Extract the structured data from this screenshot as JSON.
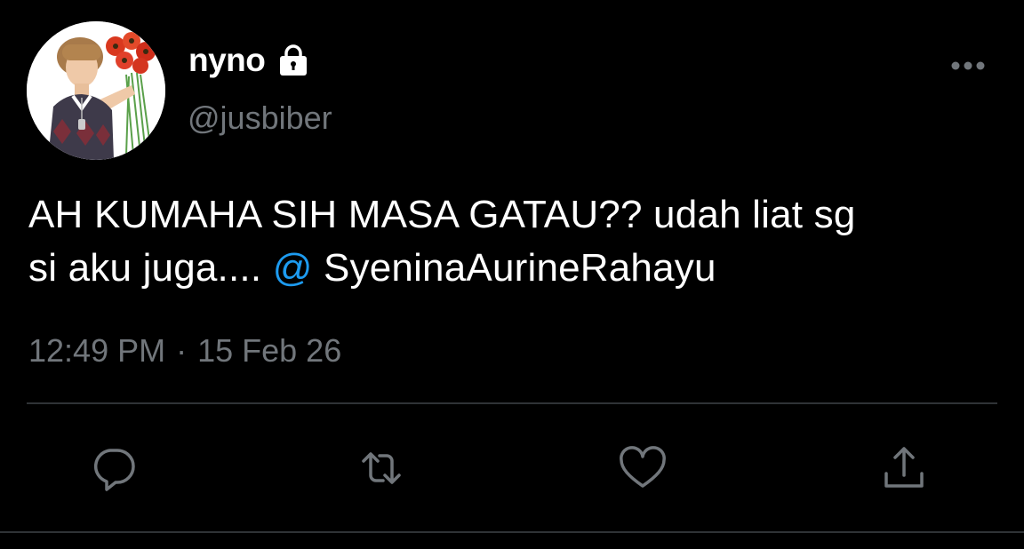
{
  "user": {
    "display_name": "nyno",
    "handle": "@jusbiber",
    "protected_icon": "lock-icon",
    "avatar": "profile-photo"
  },
  "tweet": {
    "text_line1": "AH KUMAHA SIH MASA GATAU?? udah liat sg",
    "text_line2_prefix": "si aku juga.... ",
    "mention_at": "@",
    "mention_name": " SyeninaAurineRahayu",
    "time": "12:49 PM",
    "separator": "·",
    "date": "15 Feb 26"
  },
  "actions": [
    {
      "icon": "reply-icon"
    },
    {
      "icon": "retweet-icon"
    },
    {
      "icon": "like-icon"
    },
    {
      "icon": "share-icon"
    }
  ],
  "menu": {
    "icon": "more-icon"
  },
  "colors": {
    "background": "#000000",
    "text": "#ffffff",
    "secondary": "#71767b",
    "accent": "#1d9bf0",
    "divider": "#2f3336"
  }
}
